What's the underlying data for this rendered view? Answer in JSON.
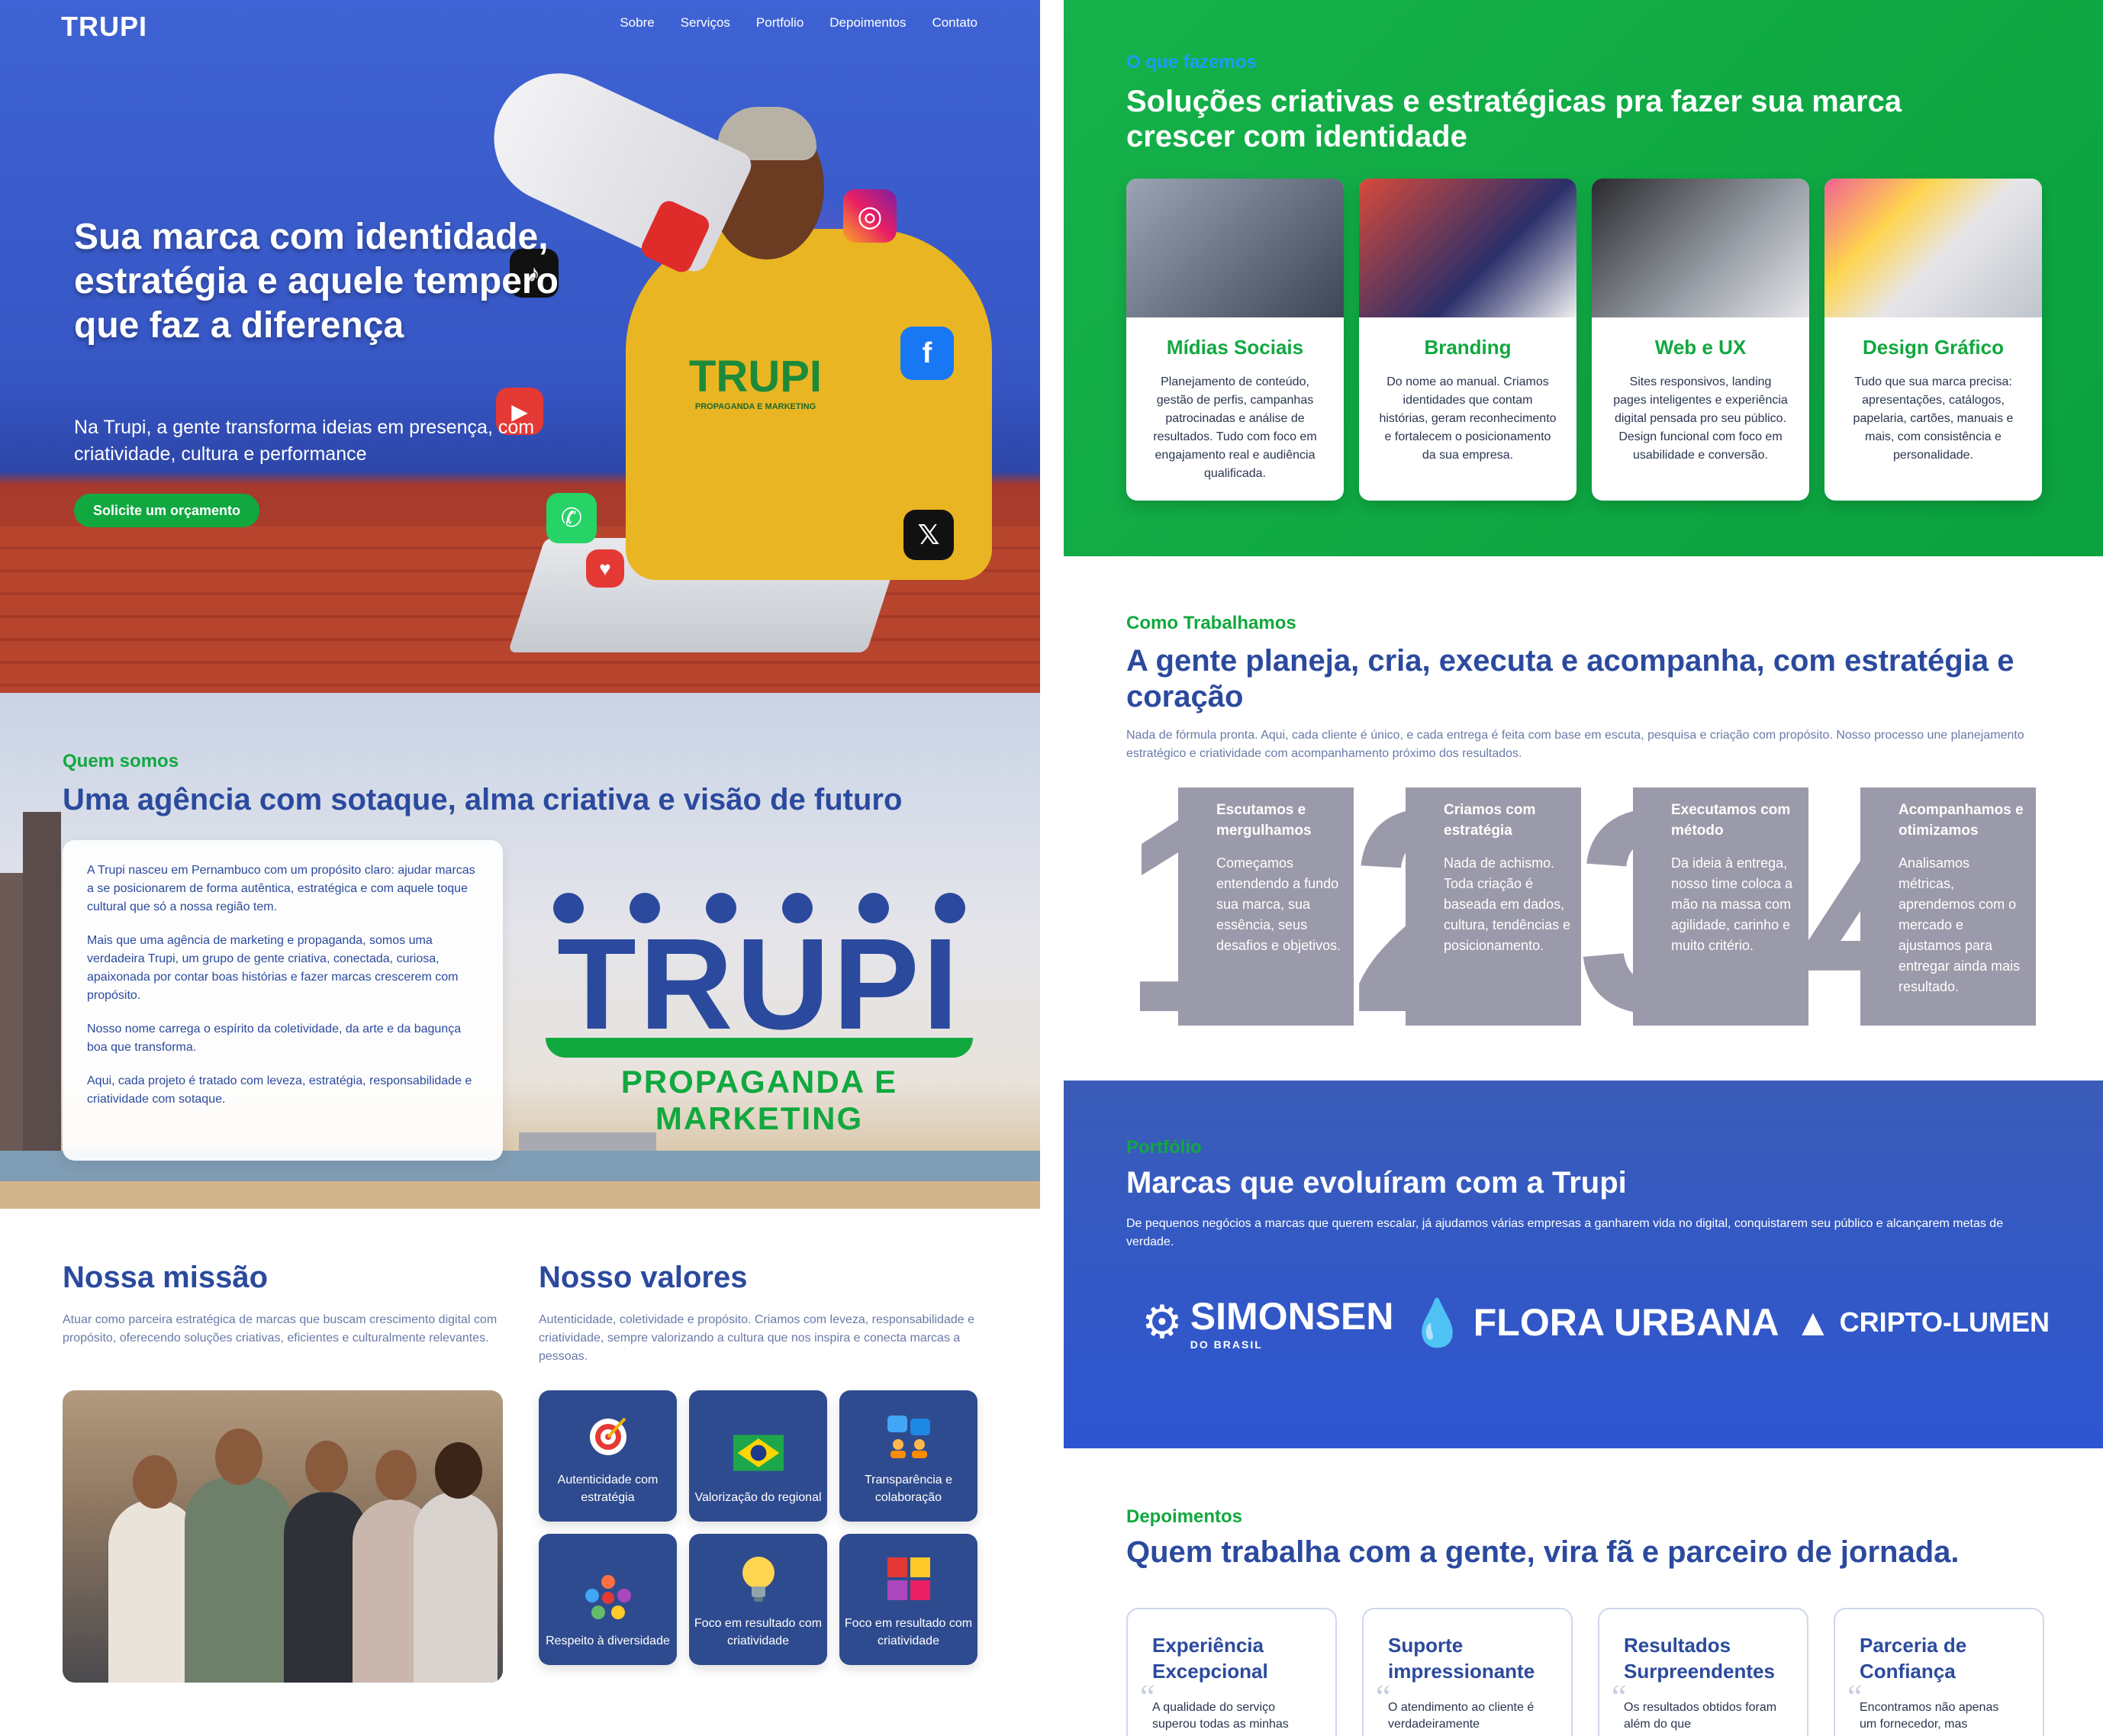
{
  "hero": {
    "logo": "TRUPI",
    "nav": [
      "Sobre",
      "Serviços",
      "Portfolio",
      "Depoimentos",
      "Contato"
    ],
    "title": "Sua marca com identidade, estratégia e aquele tempero que faz a diferença",
    "subtitle": "Na Trupi, a gente transforma ideias em presença, com criatividade, cultura e performance",
    "cta": "Solicite um orçamento",
    "shirt_logo": "TRUPI",
    "shirt_sub": "PROPAGANDA E MARKETING"
  },
  "quem": {
    "eyebrow": "Quem somos",
    "title": "Uma agência com sotaque, alma criativa e visão de futuro",
    "paragraphs": [
      "A Trupi nasceu em Pernambuco com um propósito claro: ajudar marcas a se posicionarem de forma autêntica, estratégica e com aquele toque cultural que só a nossa região tem.",
      "Mais que uma agência de marketing e propaganda, somos uma verdadeira Trupi, um grupo de gente criativa, conectada, curiosa, apaixonada por contar boas histórias e fazer marcas crescerem com propósito.",
      "Nosso nome carrega o espírito da coletividade, da arte e da bagunça boa que transforma.",
      "Aqui, cada projeto é tratado com leveza, estratégia, responsabilidade e criatividade com sotaque."
    ],
    "logo_word": "TRUPI",
    "logo_sub": "PROPAGANDA E MARKETING"
  },
  "missao": {
    "title": "Nossa missão",
    "text": "Atuar como parceira estratégica de marcas que buscam crescimento digital com propósito, oferecendo soluções criativas, eficientes e culturalmente relevantes."
  },
  "valores": {
    "title": "Nosso valores",
    "text": "Autenticidade, coletividade e propósito. Criamos com leveza, responsabilidade e criatividade, sempre valorizando a cultura que nos inspira e conecta marcas a pessoas.",
    "items": [
      {
        "label": "Autenticidade com estratégia",
        "icon": "target-icon"
      },
      {
        "label": "Valorização do regional",
        "icon": "brazil-flag-icon"
      },
      {
        "label": "Transparência e colaboração",
        "icon": "chat-people-icon"
      },
      {
        "label": "Respeito à diversidade",
        "icon": "diversity-icon"
      },
      {
        "label": "Foco em resultado com criatividade",
        "icon": "lightbulb-icon"
      },
      {
        "label": "Foco em resultado com criatividade",
        "icon": "puzzle-icon"
      }
    ]
  },
  "servicos": {
    "eyebrow": "O que fazemos",
    "title": "Soluções criativas e estratégicas pra fazer sua marca crescer com identidade",
    "cards": [
      {
        "title": "Mídias Sociais",
        "text": "Planejamento de conteúdo, gestão de perfis, campanhas patrocinadas e análise de resultados. Tudo com foco em engajamento real e audiência qualificada."
      },
      {
        "title": "Branding",
        "text": "Do nome ao manual. Criamos identidades que contam histórias, geram reconhecimento e fortalecem o posicionamento da sua empresa."
      },
      {
        "title": "Web e UX",
        "text": "Sites responsivos, landing pages inteligentes e experiência digital pensada pro seu público. Design funcional com foco em usabilidade e conversão."
      },
      {
        "title": "Design Gráfico",
        "text": "Tudo que sua marca precisa: apresentações, catálogos, papelaria, cartões, manuais e mais, com consistência e personalidade."
      }
    ]
  },
  "como": {
    "eyebrow": "Como Trabalhamos",
    "title": "A gente planeja, cria, executa e acompanha, com estratégia e coração",
    "text": "Nada de fórmula pronta. Aqui, cada cliente é único, e cada entrega é feita com base em escuta, pesquisa e criação com propósito. Nosso processo une planejamento estratégico e criatividade com acompanhamento próximo dos resultados.",
    "steps": [
      {
        "num": "1",
        "title": "Escutamos e mergulhamos",
        "text": "Começamos entendendo a fundo sua marca, sua essência, seus desafios e objetivos."
      },
      {
        "num": "2",
        "title": "Criamos com estratégia",
        "text": "Nada de achismo. Toda criação é baseada em dados, cultura, tendências e posicionamento."
      },
      {
        "num": "3",
        "title": "Executamos com método",
        "text": "Da ideia à entrega, nosso time coloca a mão na massa com agilidade, carinho e muito critério."
      },
      {
        "num": "4",
        "title": "Acompanhamos e otimizamos",
        "text": "Analisamos métricas, aprendemos com o mercado e ajustamos para entregar ainda mais resultado."
      }
    ]
  },
  "portfolio": {
    "eyebrow": "Portfólio",
    "title": "Marcas que evoluíram com a Trupi",
    "text": "De pequenos negócios a marcas que querem escalar, já ajudamos várias empresas a ganharem vida no digital, conquistarem seu público e alcançarem metas de verdade.",
    "brands": [
      {
        "name": "SIMONSEN",
        "sub": "DO BRASIL",
        "icon": "gear-icon"
      },
      {
        "name": "FLORA URBANA",
        "sub": "",
        "icon": "drop-building-icon"
      },
      {
        "name": "CRIPTO-LUMEN",
        "sub": "",
        "icon": "triangle-icon"
      }
    ]
  },
  "depoimentos": {
    "eyebrow": "Depoimentos",
    "title": "Quem trabalha com a gente, vira fã e parceiro de jornada.",
    "cards": [
      {
        "title": "Experiência Excepcional",
        "text": "A qualidade do serviço superou todas as minhas"
      },
      {
        "title": "Suporte impressionante",
        "text": "O atendimento ao cliente é verdadeiramente"
      },
      {
        "title": "Resultados Surpreendentes",
        "text": "Os resultados obtidos foram além do que"
      },
      {
        "title": "Parceria de Confiança",
        "text": "Encontramos não apenas um fornecedor, mas"
      }
    ]
  }
}
